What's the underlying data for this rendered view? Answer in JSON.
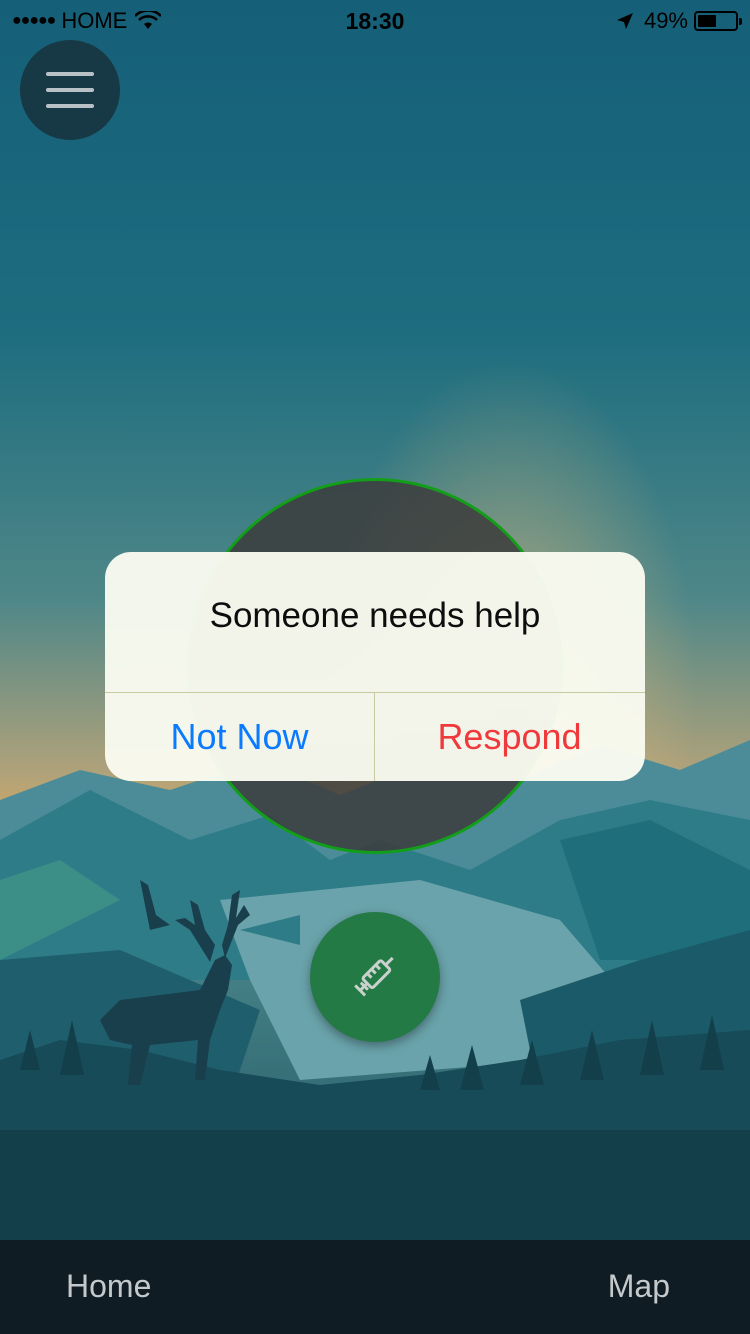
{
  "status_bar": {
    "carrier": "HOME",
    "time": "18:30",
    "battery_percent": "49%",
    "battery_level": 0.49
  },
  "alert": {
    "title": "Someone needs help",
    "cancel_label": "Not Now",
    "confirm_label": "Respond"
  },
  "tab_bar": {
    "home_label": "Home",
    "map_label": "Map"
  },
  "icons": {
    "menu": "hamburger-menu-icon",
    "fab": "syringe-icon"
  },
  "colors": {
    "cancel": "#0a7aff",
    "confirm": "#f0393a",
    "circle_ring": "#139e1a",
    "fab": "#247a45"
  }
}
